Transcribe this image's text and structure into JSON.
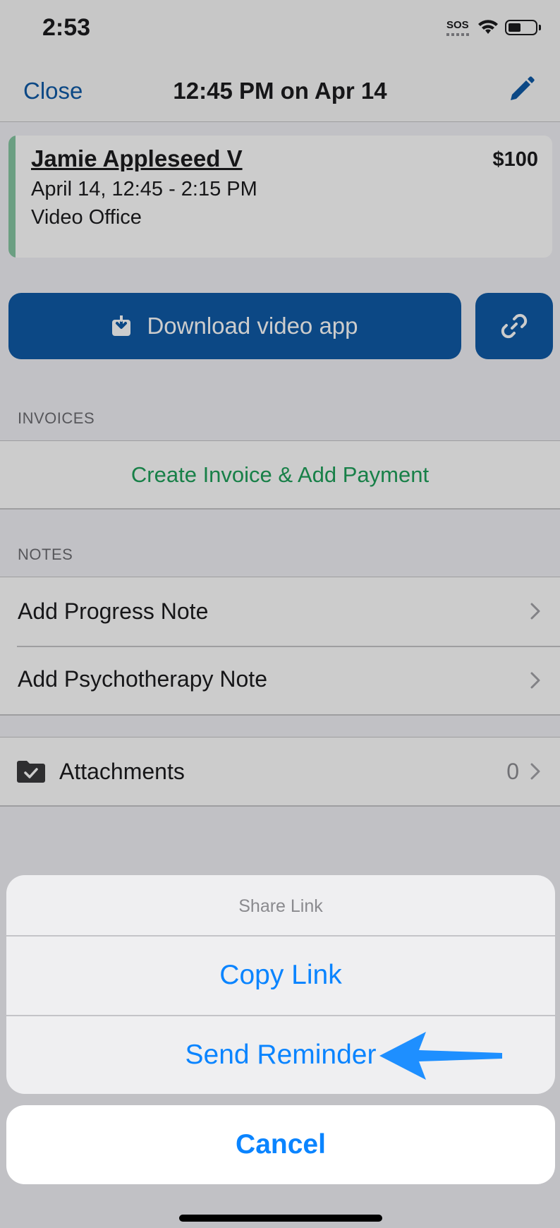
{
  "status_bar": {
    "time": "2:53",
    "sos": "SOS"
  },
  "nav": {
    "close_label": "Close",
    "title": "12:45 PM on Apr 14"
  },
  "appointment": {
    "client_name": "Jamie Appleseed V",
    "price": "$100",
    "when": "April 14, 12:45 - 2:15 PM",
    "location": "Video Office"
  },
  "actions": {
    "download_label": "Download video app"
  },
  "invoices": {
    "header": "INVOICES",
    "create_label": "Create Invoice & Add Payment"
  },
  "notes": {
    "header": "NOTES",
    "items": [
      {
        "label": "Add Progress Note"
      },
      {
        "label": "Add Psychotherapy Note"
      }
    ]
  },
  "attachments": {
    "label": "Attachments",
    "count": "0"
  },
  "sheet": {
    "title": "Share Link",
    "copy_label": "Copy Link",
    "send_label": "Send Reminder",
    "cancel_label": "Cancel"
  },
  "colors": {
    "accent": "#0f5ba7",
    "green": "#1fa05a",
    "ios_blue": "#0a84ff"
  }
}
